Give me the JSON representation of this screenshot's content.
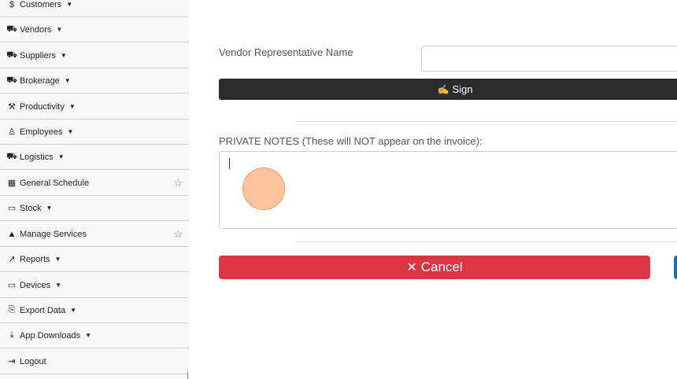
{
  "sidebar": {
    "items": [
      {
        "label": "Customers",
        "icon": "dollar-icon",
        "glyph": "$",
        "caret": true,
        "star": false
      },
      {
        "label": "Vendors",
        "icon": "truck-icon",
        "glyph": "⛟",
        "caret": true,
        "star": false
      },
      {
        "label": "Suppliers",
        "icon": "truck-fast-icon",
        "glyph": "⛟",
        "caret": true,
        "star": false
      },
      {
        "label": "Brokerage",
        "icon": "car-icon",
        "glyph": "⛟",
        "caret": true,
        "star": false
      },
      {
        "label": "Productivity",
        "icon": "hammer-icon",
        "glyph": "⚒",
        "caret": true,
        "star": false
      },
      {
        "label": "Employees",
        "icon": "person-icon",
        "glyph": "♙",
        "caret": true,
        "star": false
      },
      {
        "label": "Logistics",
        "icon": "truck-icon",
        "glyph": "⛟",
        "caret": true,
        "star": false
      },
      {
        "label": "General Schedule",
        "icon": "calendar-icon",
        "glyph": "▦",
        "caret": false,
        "star": true
      },
      {
        "label": "Stock",
        "icon": "barcode-icon",
        "glyph": "▭",
        "caret": true,
        "star": false
      },
      {
        "label": "Manage Services",
        "icon": "service-bell-icon",
        "glyph": "▲",
        "caret": false,
        "star": true
      },
      {
        "label": "Reports",
        "icon": "chart-line-icon",
        "glyph": "↗",
        "caret": true,
        "star": false
      },
      {
        "label": "Devices",
        "icon": "desktop-icon",
        "glyph": "▭",
        "caret": true,
        "star": false
      },
      {
        "label": "Export Data",
        "icon": "file-export-icon",
        "glyph": "⎘",
        "caret": true,
        "star": false
      },
      {
        "label": "App Downloads",
        "icon": "download-icon",
        "glyph": "⤓",
        "caret": true,
        "star": false
      },
      {
        "label": "Logout",
        "icon": "sign-out-icon",
        "glyph": "⇥",
        "caret": false,
        "star": false
      }
    ]
  },
  "form": {
    "vendor_rep_label": "Vendor Representative Name",
    "vendor_rep_value": "",
    "sign_label": "Sign",
    "sign_icon": "signature-icon",
    "notes_label": "PRIVATE NOTES (These will NOT appear on the invoice):",
    "notes_value": "",
    "cancel_label": "Cancel"
  },
  "colors": {
    "sign_button": "#2b2b2b",
    "cancel_button": "#dc3545",
    "submit_button": "#1d6fa5",
    "click_indicator": "#fcb080"
  }
}
